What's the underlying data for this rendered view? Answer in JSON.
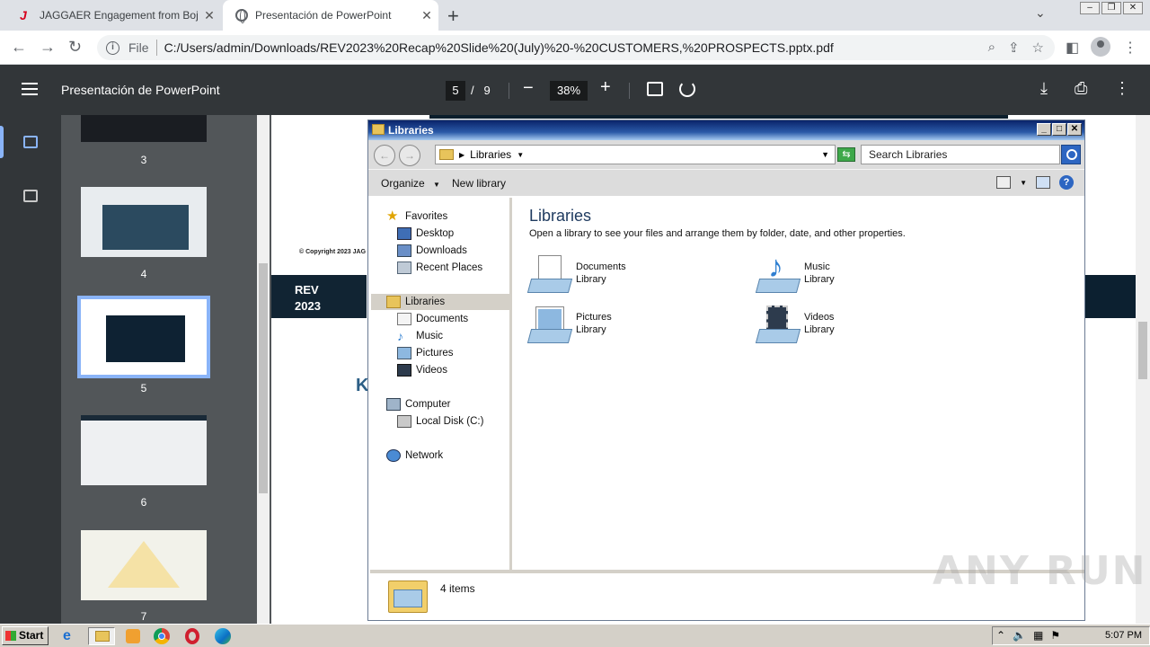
{
  "browser": {
    "tabs": [
      {
        "title": "JAGGAER Engagement from Bojana",
        "active": false
      },
      {
        "title": "Presentación de PowerPoint",
        "active": true
      }
    ],
    "address": {
      "scheme_label": "File",
      "url": "C:/Users/admin/Downloads/REV2023%20Recap%20Slide%20(July)%20-%20CUSTOMERS,%20PROSPECTS.pptx.pdf"
    }
  },
  "pdf": {
    "title": "Presentación de PowerPoint",
    "current_page": "5",
    "page_sep": "/",
    "total_pages": "9",
    "zoom": "38%",
    "thumbnails": [
      {
        "label": "3"
      },
      {
        "label": "4"
      },
      {
        "label": "5",
        "selected": true
      },
      {
        "label": "6"
      },
      {
        "label": "7"
      }
    ],
    "slide": {
      "copyright": "© Copyright 2023 JAG",
      "logo_line1": "REV",
      "logo_line2": "2023",
      "heading_fragment": "K"
    }
  },
  "explorer": {
    "window_title": "Libraries",
    "address_label": "Libraries",
    "search_placeholder": "Search Libraries",
    "commands": {
      "organize": "Organize",
      "new_library": "New library"
    },
    "nav": {
      "favorites": "Favorites",
      "desktop": "Desktop",
      "downloads": "Downloads",
      "recent_places": "Recent Places",
      "libraries": "Libraries",
      "documents": "Documents",
      "music": "Music",
      "pictures": "Pictures",
      "videos": "Videos",
      "computer": "Computer",
      "local_disk": "Local Disk (C:)",
      "network": "Network"
    },
    "content": {
      "title": "Libraries",
      "subtitle": "Open a library to see your files and arrange them by folder, date, and other properties.",
      "items": [
        {
          "name": "Documents",
          "type": "Library",
          "icon": "documents-library-icon"
        },
        {
          "name": "Music",
          "type": "Library",
          "icon": "music-library-icon"
        },
        {
          "name": "Pictures",
          "type": "Library",
          "icon": "pictures-library-icon"
        },
        {
          "name": "Videos",
          "type": "Library",
          "icon": "videos-library-icon"
        }
      ]
    },
    "status": "4 items"
  },
  "taskbar": {
    "start": "Start",
    "clock": "5:07 PM"
  },
  "watermark": "ANY RUN"
}
